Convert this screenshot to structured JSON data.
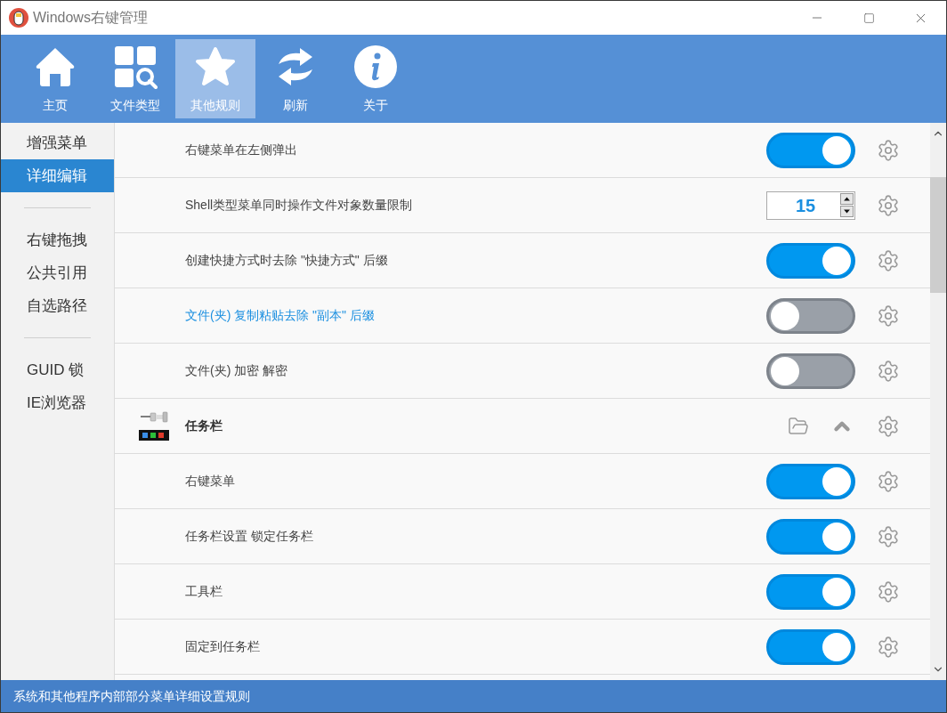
{
  "window": {
    "title": "Windows右键管理"
  },
  "toolbar": [
    {
      "label": "主页",
      "selected": false
    },
    {
      "label": "文件类型",
      "selected": false
    },
    {
      "label": "其他规则",
      "selected": true
    },
    {
      "label": "刷新",
      "selected": false
    },
    {
      "label": "关于",
      "selected": false
    }
  ],
  "sidebar": {
    "groups": [
      [
        {
          "label": "增强菜单",
          "selected": false
        },
        {
          "label": "详细编辑",
          "selected": true
        }
      ],
      [
        {
          "label": "右键拖拽",
          "selected": false
        },
        {
          "label": "公共引用",
          "selected": false
        },
        {
          "label": "自选路径",
          "selected": false
        }
      ],
      [
        {
          "label": "GUID 锁",
          "selected": false
        },
        {
          "label": "IE浏览器",
          "selected": false
        }
      ]
    ]
  },
  "rows": [
    {
      "kind": "toggle",
      "label": "右键菜单在左侧弹出",
      "on": true,
      "highlighted": false
    },
    {
      "kind": "number",
      "label": "Shell类型菜单同时操作文件对象数量限制",
      "value": "15",
      "highlighted": false
    },
    {
      "kind": "toggle",
      "label": "创建快捷方式时去除 \"快捷方式\" 后缀",
      "on": true,
      "highlighted": false
    },
    {
      "kind": "toggle",
      "label": "文件(夹) 复制粘贴去除 \"副本\" 后缀",
      "on": false,
      "highlighted": true
    },
    {
      "kind": "toggle",
      "label": "文件(夹) 加密 解密",
      "on": false,
      "highlighted": false
    },
    {
      "kind": "group",
      "label": "任务栏",
      "expanded": true
    },
    {
      "kind": "toggle",
      "label": "右键菜单",
      "on": true,
      "highlighted": false
    },
    {
      "kind": "toggle",
      "label": "任务栏设置 锁定任务栏",
      "on": true,
      "highlighted": false
    },
    {
      "kind": "toggle",
      "label": "工具栏",
      "on": true,
      "highlighted": false
    },
    {
      "kind": "toggle",
      "label": "固定到任务栏",
      "on": true,
      "highlighted": false
    }
  ],
  "status_bar": "系统和其他程序内部部分菜单详细设置规则"
}
